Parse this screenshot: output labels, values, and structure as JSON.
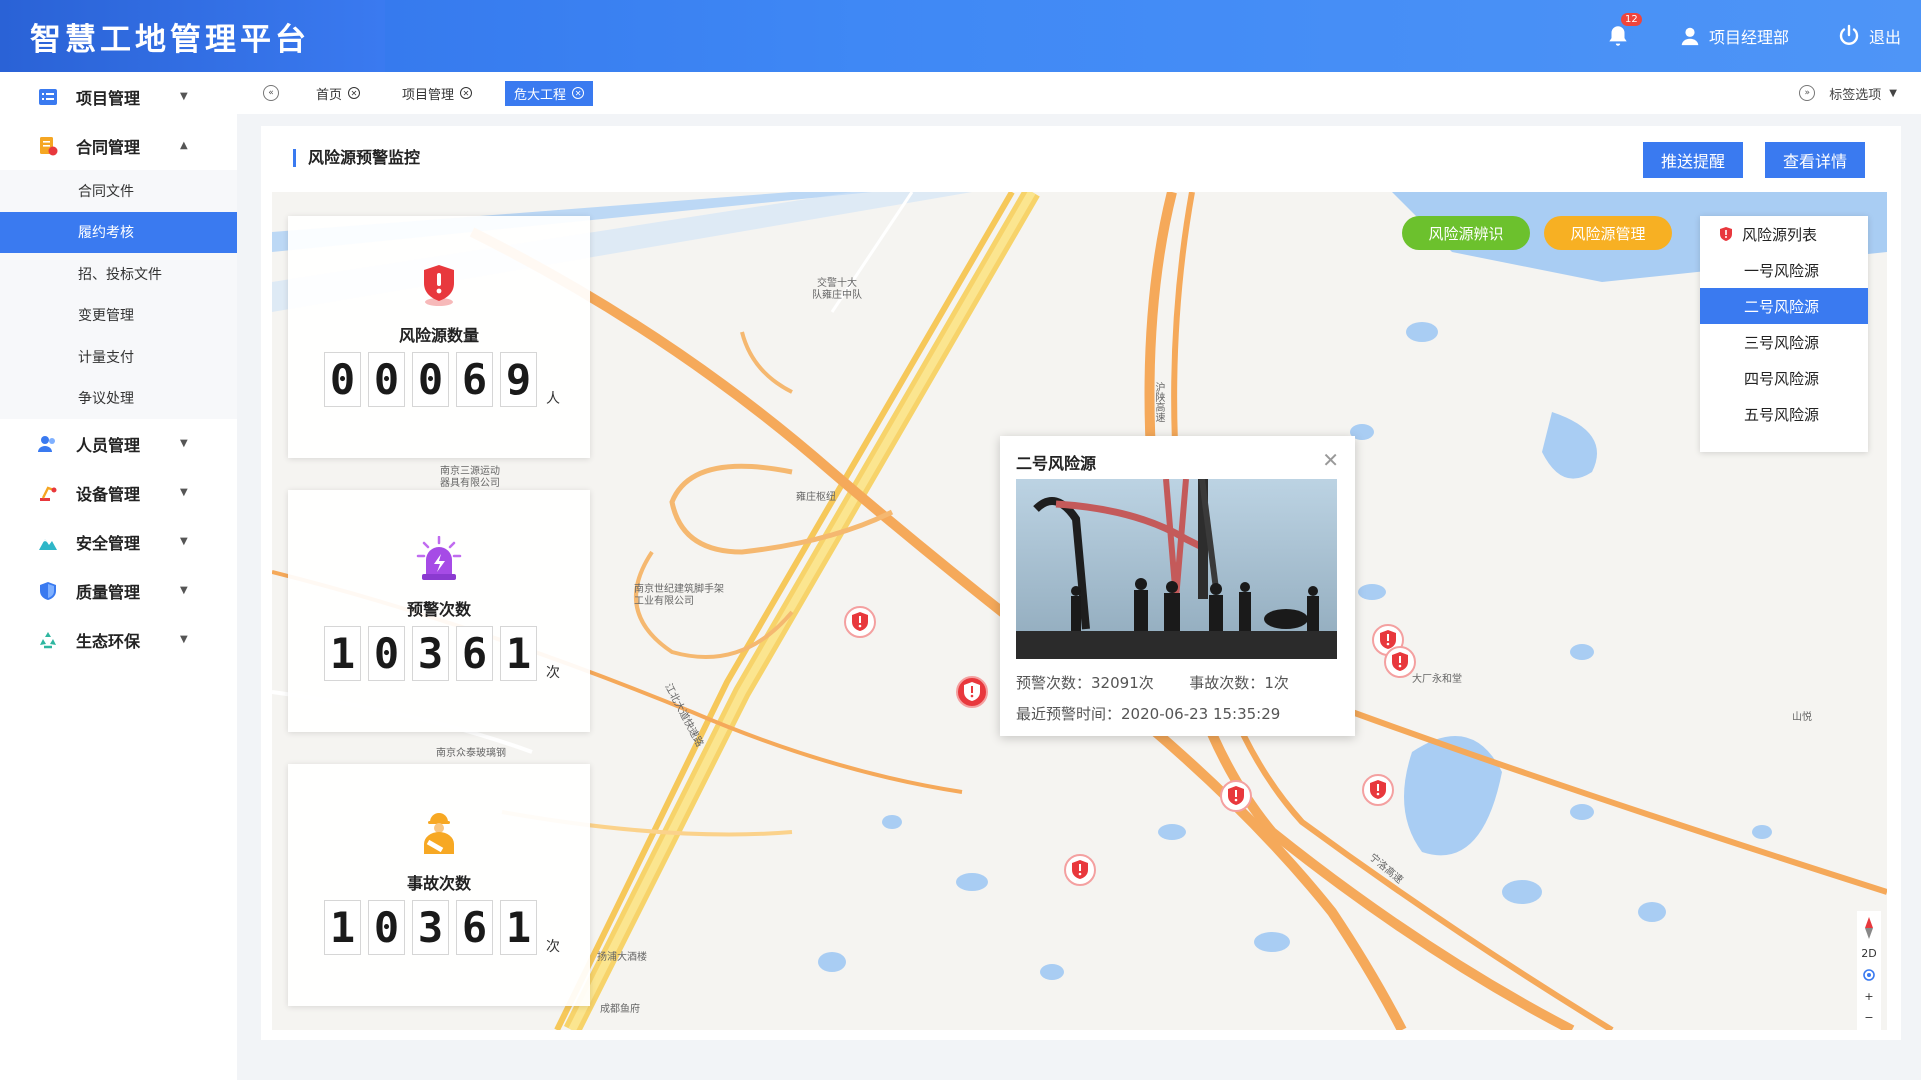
{
  "app": {
    "title": "智慧工地管理平台"
  },
  "header": {
    "notification_count": "12",
    "user_label": "项目经理部",
    "logout_label": "退出"
  },
  "sidebar": {
    "items": [
      {
        "label": "项目管理",
        "icon": "list-icon",
        "expanded": false
      },
      {
        "label": "合同管理",
        "icon": "contract-icon",
        "expanded": true
      },
      {
        "label": "人员管理",
        "icon": "people-icon",
        "expanded": false
      },
      {
        "label": "设备管理",
        "icon": "equipment-icon",
        "expanded": false
      },
      {
        "label": "安全管理",
        "icon": "mountain-icon",
        "expanded": false
      },
      {
        "label": "质量管理",
        "icon": "shield-icon",
        "expanded": false
      },
      {
        "label": "生态环保",
        "icon": "recycle-icon",
        "expanded": false
      }
    ],
    "submenu": [
      "合同文件",
      "履约考核",
      "招、投标文件",
      "变更管理",
      "计量支付",
      "争议处理"
    ],
    "active_submenu": "履约考核"
  },
  "tabs": {
    "items": [
      "首页",
      "项目管理",
      "危大工程"
    ],
    "active": "危大工程",
    "options_label": "标签选项"
  },
  "panel": {
    "title": "风险源预警监控",
    "push_button": "推送提醒",
    "detail_button": "查看详情"
  },
  "stats": [
    {
      "label": "风险源数量",
      "digits": [
        "0",
        "0",
        "0",
        "6",
        "9"
      ],
      "unit": "人",
      "icon": "alert-shield-icon"
    },
    {
      "label": "预警次数",
      "digits": [
        "1",
        "0",
        "3",
        "6",
        "1"
      ],
      "unit": "次",
      "icon": "siren-icon"
    },
    {
      "label": "事故次数",
      "digits": [
        "1",
        "0",
        "3",
        "6",
        "1"
      ],
      "unit": "次",
      "icon": "injured-worker-icon"
    }
  ],
  "map_controls": {
    "identify_label": "风险源辨识",
    "manage_label": "风险源管理",
    "identify_color": "#6cc12d",
    "manage_color": "#f7b023"
  },
  "risk_list": {
    "title": "风险源列表",
    "items": [
      "一号风险源",
      "二号风险源",
      "三号风险源",
      "四号风险源",
      "五号风险源"
    ],
    "active": "二号风险源"
  },
  "popup": {
    "title": "二号风险源",
    "warning_label": "预警次数：",
    "warning_value": "32091次",
    "accident_label": "事故次数：",
    "accident_value": "1次",
    "last_warning_label": "最近预警时间：",
    "last_warning_value": "2020-06-23 15:35:29"
  },
  "map_labels": {
    "l1": "交警十大",
    "l2": "队雍庄中队",
    "l3": "南京三源运动",
    "l4": "器具有限公司",
    "l5": "雍庄枢纽",
    "l6": "南京世纪建筑脚手架",
    "l7": "工业有限公司",
    "l8": "南京众泰玻璃钢",
    "l9": "扬浦大酒楼",
    "l10": "成都鱼府",
    "l11": "大厂永和堂",
    "l12": "沪陕高速",
    "l13": "江北大道快速路",
    "l14": "宁洛高速",
    "l15": "山悦"
  },
  "colors": {
    "accent": "#3a7af0",
    "danger": "#e8383d"
  }
}
